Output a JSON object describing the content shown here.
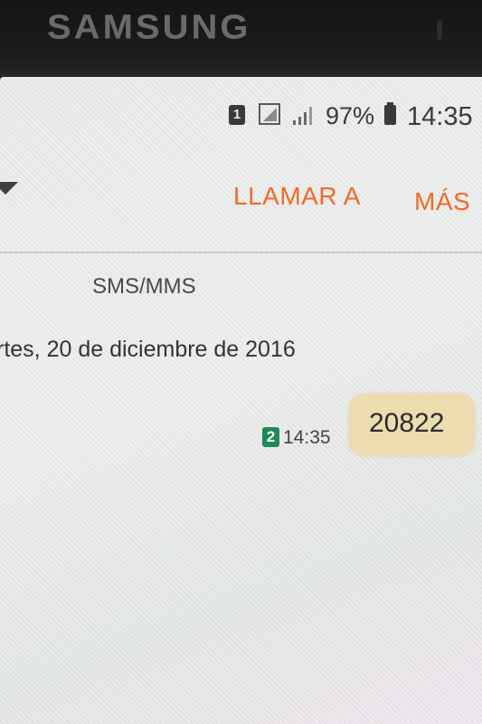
{
  "device": {
    "brand": "SAMSUNG"
  },
  "status_bar": {
    "sim_slot": "1",
    "battery_percent": "97%",
    "clock": "14:35",
    "icons": [
      "sim-slot-icon",
      "signal-box-icon",
      "signal-bars-icon",
      "battery-icon"
    ]
  },
  "action_bar": {
    "back_icon": "back-arrow-icon",
    "call_label": "LLAMAR A",
    "more_label": "MÁS"
  },
  "conversation": {
    "channel_label": "SMS/MMS",
    "date_header": "rtes, 20 de diciembre de 2016",
    "messages": [
      {
        "sim_badge": "2",
        "time": "14:35",
        "text": "20822"
      }
    ]
  },
  "colors": {
    "accent": "#f06a2a",
    "sim_badge": "#1f8a55",
    "bubble": "#ecdcb0"
  }
}
